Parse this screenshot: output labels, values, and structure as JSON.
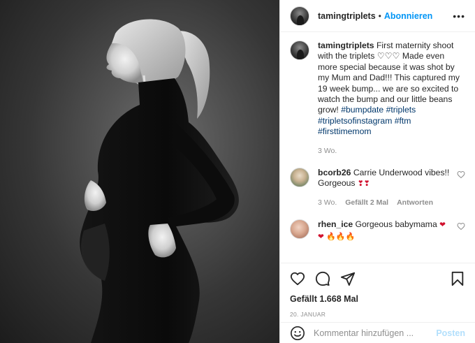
{
  "post": {
    "username": "tamingtriplets",
    "separator": "•",
    "follow_label": "Abonnieren",
    "more_label": "•••"
  },
  "caption": {
    "username": "tamingtriplets",
    "text_1": "First maternity shoot with the triplets",
    "hearts": "♡♡♡",
    "text_2": "Made even more special because it was shot by my Mum and Dad!!! This captured my 19 week bump... we are so excited to watch the bump and our little beans grow!",
    "hashtags": "#bumpdate #triplets #tripletsofinstagram #ftm #firsttimemom",
    "time": "3 Wo."
  },
  "comments": [
    {
      "username": "bcorb26",
      "text": "Carrie Underwood vibes!! Gorgeous",
      "emoji": "❣❣",
      "time": "3 Wo.",
      "likes": "Gefällt 2 Mal",
      "reply": "Antworten"
    },
    {
      "username": "rhen_ice",
      "text": "Gorgeous babymama",
      "emoji_heart": "❤",
      "emoji_line": "❤",
      "emoji_fire": "🔥🔥🔥"
    }
  ],
  "actions": {
    "likes": "Gefällt 1.668 Mal",
    "date": "20. Januar",
    "icons": [
      "heart-icon",
      "comment-icon",
      "share-icon",
      "bookmark-icon"
    ]
  },
  "add_comment": {
    "placeholder": "Kommentar hinzufügen ...",
    "post_label": "Posten"
  },
  "colors": {
    "link": "#0095f6",
    "hashtag": "#00376b",
    "muted": "#8e8e8e",
    "post_disabled": "#b2dffc"
  }
}
